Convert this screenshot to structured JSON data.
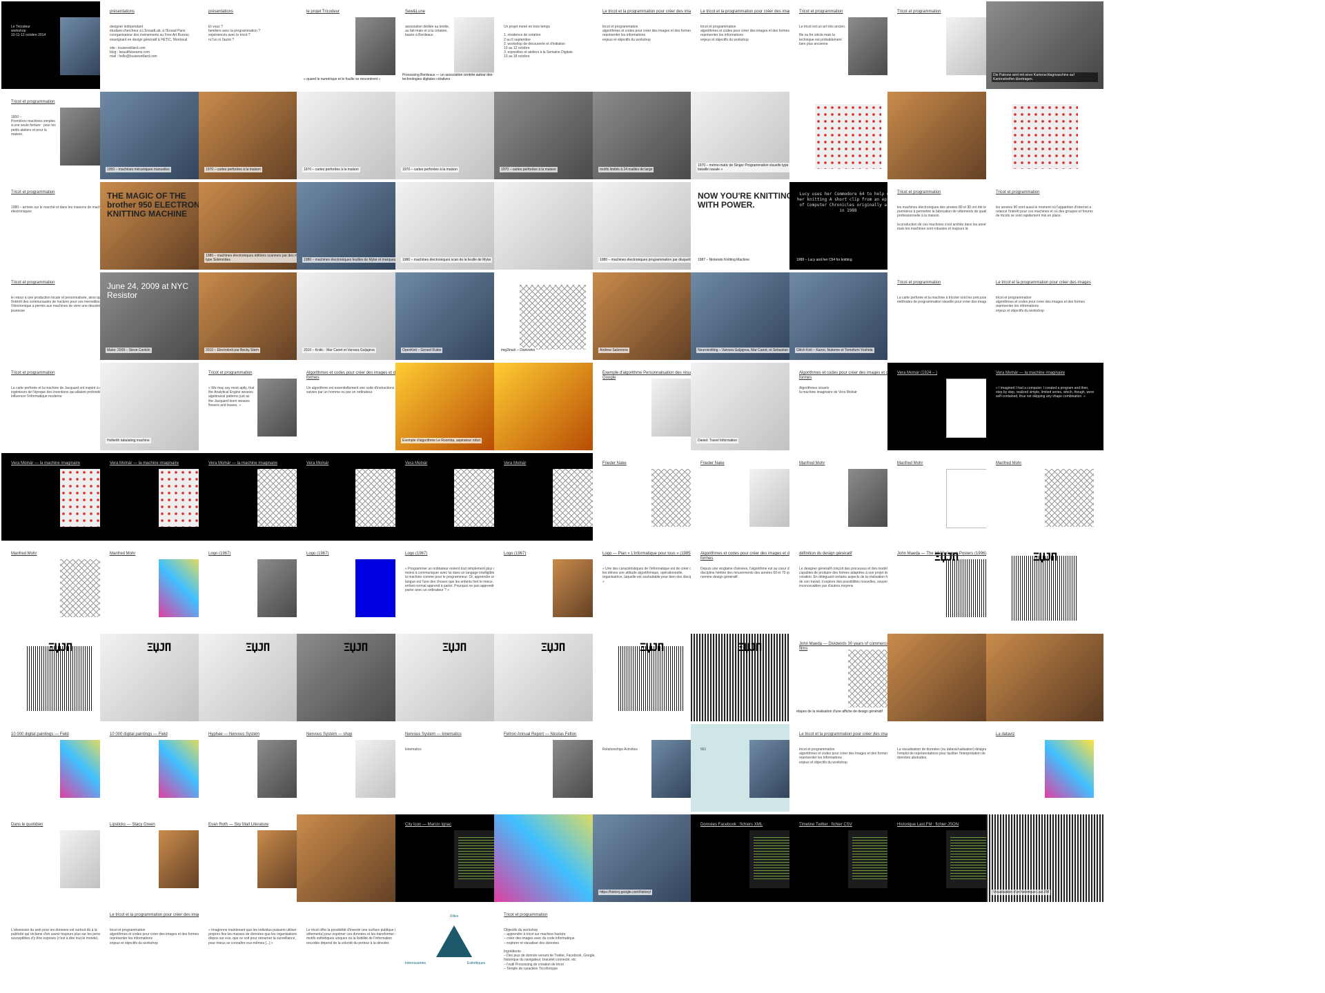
{
  "slides": [
    {
      "id": "r1c1",
      "dark": true,
      "title": "",
      "body": "Le Tricodeur\nworkshop\n10-11-12 octobre 2014",
      "caption": ""
    },
    {
      "id": "r1c2",
      "title": "présentations",
      "body": "designer indépendant\nétudiant-chercheur à L'EnsadLab, à l'Ensad Paris\ncoorganisateur des événements au Free Art Bureau\nenseignant en design génératif à HETIC, Montreuil\n\nsite : louiseveillard.com\nblog : beautifulseams.com\nmail : hello@louiseveillard.com",
      "caption": ""
    },
    {
      "id": "r1c3",
      "title": "présentations",
      "body": "Et vous ?\nfamiliers avec la programmation ?\nexpériencés avec le tricot ?\nni l'un ni l'autre ?",
      "caption": ""
    },
    {
      "id": "r1c4",
      "title": "le projet Tricodeur",
      "body": "",
      "caption": "« quand le numérique et le fouille se rencontrent »"
    },
    {
      "id": "r1c5",
      "title": "Sew&Lune",
      "body": "association dédiée au textile, au fait-main et à la création, basée à Bordeaux",
      "caption": "Processing Bordeaux — un association centrée autour des technologies digitales créatives"
    },
    {
      "id": "r1c6",
      "title": "",
      "body": "Un projet mené en trois temps\n\n1. résidence de création\n   2 au 6 septembre\n2. workshop de découverte et d'initiation\n   10 au 12 octobre\n3. exposition et ateliers à la Semaine Digitale\n   13 au 18 octobre",
      "caption": ""
    },
    {
      "id": "r1c7",
      "title": "Le tricot et la programmation pour créer des images",
      "body": "tricot et programmation\nalgorithmes et codes pour créer des images et des formes\nreprésenter les informations\nenjeux et objectifs du workshop",
      "caption": ""
    },
    {
      "id": "r1c8",
      "title": "Le tricot et la programmation pour créer des images",
      "body": "tricot et programmation\nalgorithmes et codes pour créer des images et des formes\nreprésenter les informations\nenjeux et objectifs du workshop",
      "caption": ""
    },
    {
      "id": "r1c9",
      "title": "Tricot et programmation",
      "body": "Le tricot est un art très ancien.\n\nfile ou fre siècle mais la technique est probablement bien plus ancienne",
      "caption": ""
    },
    {
      "id": "r1c10",
      "title": "Tricot et programmation",
      "body": "",
      "caption": ""
    },
    {
      "id": "r1c11",
      "dark": true,
      "title": "",
      "body": "",
      "caption": "Die Patrone wird mit einer Kartenschlagmaschine auf Kartonstreifen übertragen."
    },
    {
      "id": "r2c1",
      "title": "Tricot et programmation",
      "body": "1800 –\nPremières machines simples à une seule fonture : pour les petits ateliers et pour la maison.",
      "caption": ""
    },
    {
      "id": "r2c2",
      "title": "",
      "body": "",
      "caption": "1950 – machines mécaniques manuelles"
    },
    {
      "id": "r2c3",
      "title": "",
      "body": "",
      "caption": "1970 – cartes perforées à la maison"
    },
    {
      "id": "r2c4",
      "title": "",
      "body": "",
      "caption": "1970 – cartes perforées à la maison"
    },
    {
      "id": "r2c5",
      "title": "",
      "body": "",
      "caption": "1970 – cartes perforées à la maison"
    },
    {
      "id": "r2c6",
      "title": "",
      "body": "",
      "caption": "1970 – cartes perforées à la maison"
    },
    {
      "id": "r2c7",
      "title": "",
      "body": "",
      "caption": "motifs limités à 24 mailles de large"
    },
    {
      "id": "r2c8",
      "title": "",
      "body": "",
      "caption": "1970 – mémo-matic de Singer\nProgrammation visuelle\ntype « bataille navale »"
    },
    {
      "id": "r2c9",
      "title": "",
      "body": "",
      "caption": ""
    },
    {
      "id": "r2c10",
      "title": "",
      "body": "",
      "caption": ""
    },
    {
      "id": "r2c11",
      "title": "",
      "body": "",
      "caption": ""
    },
    {
      "id": "r3c1",
      "title": "Tricot et programmation",
      "body": "1980 – arrivée sur le marché et dans les maisons de machines électroniques",
      "caption": ""
    },
    {
      "id": "r3c2",
      "title": "",
      "big": "THE MAGIC OF THE brother 950 ELECTRONIC KNITTING MACHINE",
      "body": "",
      "caption": ""
    },
    {
      "id": "r3c3",
      "title": "",
      "body": "",
      "caption": "1980 – machines électroniques éditions scanners par des moteurs type Solénoïdes"
    },
    {
      "id": "r3c4",
      "title": "",
      "body": "",
      "caption": "1980 – machines électroniques feuilles de Mylar et marqueur"
    },
    {
      "id": "r3c5",
      "title": "",
      "body": "",
      "caption": "1980 – machines électroniques scan de la feuille de Mylar"
    },
    {
      "id": "r3c6",
      "title": "",
      "body": "",
      "caption": ""
    },
    {
      "id": "r3c7",
      "title": "",
      "body": "",
      "caption": "1980 – machines électroniques programmation par disquette"
    },
    {
      "id": "r3c8",
      "title": "",
      "big": "NOW YOU'RE KNITTING WITH POWER.",
      "body": "",
      "caption": "1987 – Nintendo Knitting Machine"
    },
    {
      "id": "r3c9",
      "dark": true,
      "title": "",
      "big": "Lucy uses her Commodore 64 to help with her knitting\n\nA short clip from an episode of Computer Chronicles originally aired in 1988",
      "body": "",
      "caption": "1988 – Lucy and her C64 for knitting"
    },
    {
      "id": "r3c10",
      "title": "Tricot et programmation",
      "body": "les machines électroniques des années 80 et 90 ont été les premières à permettre la fabrication de vêtements de qualité professionnelle à la maison.\n\nla production de ces machines s'est arrêtée dans les années 90 mais les machines sont robustes et toujours là",
      "caption": ""
    },
    {
      "id": "r3c11",
      "title": "Tricot et programmation",
      "body": "les années 90 sont aussi le moment où l'apparition d'internet a relancé l'intérêt pour ces machines et où des groupes et forums de tricots se sont rapidement mis en place.",
      "caption": ""
    },
    {
      "id": "r4c1",
      "title": "Tricot et programmation",
      "body": "le retour à une production locale et personnalisée, ainsi que l'intérêt des communautés de hackers pour ces merveilles de l'électronique a permis aux machines de vivre une deuxième jeunesse",
      "caption": ""
    },
    {
      "id": "r4c2",
      "blue": true,
      "title": "",
      "big": "June 24, 2009 at NYC Resistor",
      "body": "",
      "caption": "Make: 2009 – Steve Conklin"
    },
    {
      "id": "r4c3",
      "title": "",
      "body": "",
      "caption": "2010 – Electroknit par Becky Stern"
    },
    {
      "id": "r4c4",
      "title": "",
      "body": "",
      "caption": "2010 – Knitic : Mar Canet et Varvara Guljajeva"
    },
    {
      "id": "r4c5",
      "peach": true,
      "title": "",
      "body": "",
      "caption": "OpenKnit – Gerard Rubio"
    },
    {
      "id": "r4c6",
      "title": "",
      "body": "",
      "caption": "img2track – Davivorks"
    },
    {
      "id": "r4c7",
      "title": "",
      "body": "",
      "caption": "Andrew Salomone"
    },
    {
      "id": "r4c8",
      "title": "",
      "body": "",
      "caption": "Neuroknitting – Varvara Guljajeva, Mar Canet, et Sebastian Mealla"
    },
    {
      "id": "r4c9",
      "title": "",
      "body": "",
      "caption": "Glitch Knit – Karoo, Nukeme et Tomofumi Yoshida"
    },
    {
      "id": "r4c10",
      "title": "Tricot et programmation",
      "body": "La carte perforée et la machine à tricoter sont les précurseurs de méthodes de programmation visuelle pour créer des images",
      "caption": ""
    },
    {
      "id": "r4c11",
      "title": "Le tricot et la programmation pour créer des images",
      "body": "tricot et programmation\nalgorithmes et codes pour créer des images et des formes\nreprésenter les informations\nenjeux et objectifs du workshop",
      "caption": ""
    },
    {
      "id": "r5c1",
      "title": "Tricot et programmation",
      "body": "La carte perforée et la machine de Jacquard ont inspiré à deux ingénieurs de l'époque des inventions qui allaient profondément influencer l'informatique moderne",
      "caption": ""
    },
    {
      "id": "r5c2",
      "title": "",
      "body": "",
      "caption": "Hollerith tabulating machine"
    },
    {
      "id": "r5c3",
      "title": "Tricot et programmation",
      "body": "« We may say most aptly, that the Analytical Engine weaves algebraical patterns just as the Jacquard-loom weaves flowers and leaves. »",
      "caption": ""
    },
    {
      "id": "r5c4",
      "title": "Algorithmes et codes pour créer des images et des formes",
      "body": "Un algorithme est essentiellement une suite d'instructions suivies par un homme ou par un ordinateur.",
      "caption": ""
    },
    {
      "id": "r5c5",
      "title": "",
      "body": "",
      "caption": "Exemple d'algorithme\nLe Roomba, aspirateur robot"
    },
    {
      "id": "r5c6",
      "title": "",
      "body": "",
      "caption": ""
    },
    {
      "id": "r5c7",
      "title": "Exemple d'algorithme\nPersonnalisation des résultats Google",
      "body": "",
      "caption": ""
    },
    {
      "id": "r5c8",
      "title": "",
      "body": "",
      "caption": "Daniel: Travel Information"
    },
    {
      "id": "r5c9",
      "title": "Algorithmes et codes pour créer des images et des formes",
      "body": "Algorithmes visuels\nla machine imaginaire de Vera Molnár",
      "caption": ""
    },
    {
      "id": "r5c10",
      "dark": true,
      "title": "Vera Molnár (1924 – )",
      "body": "",
      "caption": ""
    },
    {
      "id": "r5c11",
      "dark": true,
      "title": "Vera Molnár — la machine imaginaire",
      "body": "« I imagined I had a computer. I created a program and then, step by step, realized simple, limited series, which, though, were self-contained, thus not skipping any shape combination. »",
      "caption": ""
    },
    {
      "id": "r6c1",
      "dark": true,
      "title": "Vera Molnár — la machine imaginaire",
      "body": "",
      "caption": ""
    },
    {
      "id": "r6c2",
      "dark": true,
      "title": "Vera Molnár — la machine imaginaire",
      "body": "",
      "caption": ""
    },
    {
      "id": "r6c3",
      "dark": true,
      "title": "Vera Molnár — la machine imaginaire",
      "body": "",
      "caption": ""
    },
    {
      "id": "r6c4",
      "dark": true,
      "title": "Vera Molnár",
      "body": "",
      "caption": ""
    },
    {
      "id": "r6c5",
      "dark": true,
      "title": "Vera Molnár",
      "body": "",
      "caption": ""
    },
    {
      "id": "r6c6",
      "dark": true,
      "title": "Vera Molnár",
      "body": "",
      "caption": ""
    },
    {
      "id": "r6c7",
      "title": "Frieder Nake",
      "body": "",
      "caption": ""
    },
    {
      "id": "r6c8",
      "title": "Frieder Nake",
      "body": "",
      "caption": ""
    },
    {
      "id": "r6c9",
      "title": "Manfred Mohr",
      "body": "",
      "caption": ""
    },
    {
      "id": "r6c10",
      "title": "Manfred Mohr",
      "body": "",
      "caption": ""
    },
    {
      "id": "r6c11",
      "title": "Manfred Mohr",
      "body": "",
      "caption": ""
    },
    {
      "id": "r7c1",
      "title": "Manfred Mohr",
      "body": "",
      "caption": ""
    },
    {
      "id": "r7c2",
      "title": "Manfred Mohr",
      "body": "",
      "caption": ""
    },
    {
      "id": "r7c3",
      "title": "Logo (1967)",
      "body": "",
      "caption": ""
    },
    {
      "id": "r7c4",
      "title": "Logo (1967)",
      "body": "",
      "caption": ""
    },
    {
      "id": "r7c5",
      "title": "Logo (1967)",
      "body": "« Programmer un ordinateur revient tout simplement plus ou moins à communiquer avec lui dans un langage intelligible pour la machine comme pour le programmeur. Or, apprendre une langue est l'une des choses que les enfants font le mieux. Tout enfant normal apprend à parler. Pourquoi ne pas apprendre à parler avec un ordinateur ? »",
      "caption": ""
    },
    {
      "id": "r7c6",
      "title": "Logo (1967)",
      "body": "",
      "caption": ""
    },
    {
      "id": "r7c7",
      "title": "Logo — Plan « L'informatique pour tous » (1985)",
      "body": "« Une des caractéristiques de l'informatique est de créer chez les élèves une attitude algorithmique, opérationnelle, organisatrice, laquelle est souhaitable pour bien des disciplines. »",
      "caption": ""
    },
    {
      "id": "r7c8",
      "title": "Algorithmes et codes pour créer des images et des formes",
      "body": "Depuis une vingtaine d'années, l'algorithme est au cœur d'une discipline héritée des mouvements des années 60 et 70 qu'on nomme design génératif",
      "caption": ""
    },
    {
      "id": "r7c9",
      "title": "définition du design génératif",
      "body": "Le designer génératif conçoit des processus et des modèles capables de produire des formes adaptées à son projet de création. En déléguant certains aspects de la réalisation formelle de son travail, il explore des possibilités nouvelles, souvent inconcevables par d'autres moyens",
      "caption": ""
    },
    {
      "id": "r7c10",
      "title": "John Maeda — The 10 Morisawa Posters (1996)",
      "body": "",
      "caption": ""
    },
    {
      "id": "r7c11",
      "title": "",
      "body": "",
      "caption": ""
    },
    {
      "id": "r8c1",
      "title": "",
      "body": "",
      "caption": ""
    },
    {
      "id": "r8c2",
      "title": "",
      "body": "",
      "caption": ""
    },
    {
      "id": "r8c3",
      "title": "",
      "body": "",
      "caption": ""
    },
    {
      "id": "r8c4",
      "title": "",
      "body": "",
      "caption": ""
    },
    {
      "id": "r8c5",
      "title": "",
      "body": "",
      "caption": ""
    },
    {
      "id": "r8c6",
      "title": "",
      "body": "",
      "caption": ""
    },
    {
      "id": "r8c7",
      "title": "",
      "body": "",
      "caption": ""
    },
    {
      "id": "r8c8",
      "title": "",
      "body": "",
      "caption": ""
    },
    {
      "id": "r8c9",
      "title": "John Maeda — Dividends 30 years of commercial films",
      "body": "",
      "caption": "étapes de la réalisation d'une affiche de design génératif"
    },
    {
      "id": "r8c10",
      "title": "",
      "body": "",
      "caption": ""
    },
    {
      "id": "r8c11",
      "title": "",
      "body": "",
      "caption": ""
    },
    {
      "id": "r9c1",
      "title": "10 000 digital paintings — Field",
      "body": "",
      "caption": ""
    },
    {
      "id": "r9c2",
      "title": "10 000 digital paintings — Field",
      "body": "",
      "caption": ""
    },
    {
      "id": "r9c3",
      "title": "Hyphae — Nervous System",
      "body": "",
      "caption": ""
    },
    {
      "id": "r9c4",
      "title": "Nervous System — shop",
      "body": "",
      "caption": ""
    },
    {
      "id": "r9c5",
      "title": "Nervous System — kinematics",
      "body": "kinematics",
      "caption": ""
    },
    {
      "id": "r9c6",
      "title": "Fellron Annual Report — Nicolas Felton",
      "body": "",
      "caption": ""
    },
    {
      "id": "r9c7",
      "title": "",
      "body": "Relationships     Activities",
      "caption": ""
    },
    {
      "id": "r9c8",
      "teal": true,
      "title": "",
      "body": "561",
      "caption": ""
    },
    {
      "id": "r9c9",
      "title": "Le tricot et la programmation pour créer des images",
      "body": "tricot et programmation\nalgorithmes et codes pour créer des images et des formes\nreprésenter les informations\nenjeux et objectifs du workshop",
      "caption": ""
    },
    {
      "id": "r9c10",
      "title": "",
      "body": "La visualisation de données (ou dataviz/ualisation) désigne l'emploi de représentations pour faciliter l'interprétation de données abstraites.",
      "caption": ""
    },
    {
      "id": "r9c11",
      "title": "La dataviz",
      "body": "",
      "caption": ""
    },
    {
      "id": "r10c1",
      "title": "Dans le quotidien",
      "body": "",
      "caption": ""
    },
    {
      "id": "r10c2",
      "title": "Lipsticks — Stacy Green",
      "body": "",
      "caption": ""
    },
    {
      "id": "r10c3",
      "title": "Evan Roth — Sky Mall Literature",
      "body": "",
      "caption": ""
    },
    {
      "id": "r10c4",
      "title": "",
      "body": "",
      "caption": ""
    },
    {
      "id": "r10c5",
      "dark": true,
      "title": "City Icon — Marcin Ignac",
      "body": "",
      "caption": ""
    },
    {
      "id": "r10c6",
      "title": "",
      "body": "",
      "caption": ""
    },
    {
      "id": "r10c7",
      "title": "",
      "body": "",
      "caption": "https://history.google.com/history/"
    },
    {
      "id": "r10c8",
      "dark": true,
      "title": "Données Facebook : fichiers XML",
      "body": "",
      "caption": ""
    },
    {
      "id": "r10c9",
      "dark": true,
      "title": "Timeline Twitter : fichier CSV",
      "body": "",
      "caption": ""
    },
    {
      "id": "r10c10",
      "dark": true,
      "title": "Historique Last.FM : fichier JSON",
      "body": "",
      "caption": ""
    },
    {
      "id": "r10c11",
      "title": "",
      "body": "",
      "caption": "Visualisation d'un historique Last.FM"
    },
    {
      "id": "r11c1",
      "title": "",
      "body": "L'obsession du web pour les données est surtout dû à la publicité qui réclame d'en savoir toujours plus sur les personnes susceptibles d'y être exposés (c'est à dire tout le monde).",
      "caption": ""
    },
    {
      "id": "r11c2",
      "title": "Le tricot et la programmation pour créer des images",
      "body": "tricot et programmation\nalgorithmes et codes pour créer des images et des formes\nreprésenter les informations\nenjeux et objectifs du workshop",
      "caption": ""
    },
    {
      "id": "r11c3",
      "title": "",
      "body": "« Imaginons maintenant que les individus puissent utiliser à leurs propres fins les masses de données que les organisations dispos sur eux, que ce soit pour retourner la surveillance, ou pour mieux se connaître eux-mêmes [...] »",
      "caption": ""
    },
    {
      "id": "r11c4",
      "title": "",
      "body": "Le tricot offre la possibilité d'investir une surface publique (les vêtements) pour exprimer ces données et les transformer en motifs esthétiques uniques où la lisibilité de l'information encodée dépend de la volonté du porteur à la dévoiler.",
      "caption": ""
    },
    {
      "id": "r11c5",
      "title": "",
      "body": "",
      "caption": "",
      "triangle": {
        "top": "Utiles",
        "left": "Intéressantes",
        "right": "Esthétiques"
      }
    },
    {
      "id": "r11c6",
      "title": "Tricot et programmation",
      "body": "Objectifs du workshop\n– apprendre à tricot sur machine hackée\n– créer des images avec du code informatique\n– explorer et visualiser des données\n\nIngrédients\n– Des jeux de donnée venant de Twitter, Facebook, Google, historique du navigateur, bracelet connecté, etc\n– l'outil Processing de création de tricot\n– Temple de caractère Tricofontype",
      "caption": ""
    }
  ]
}
